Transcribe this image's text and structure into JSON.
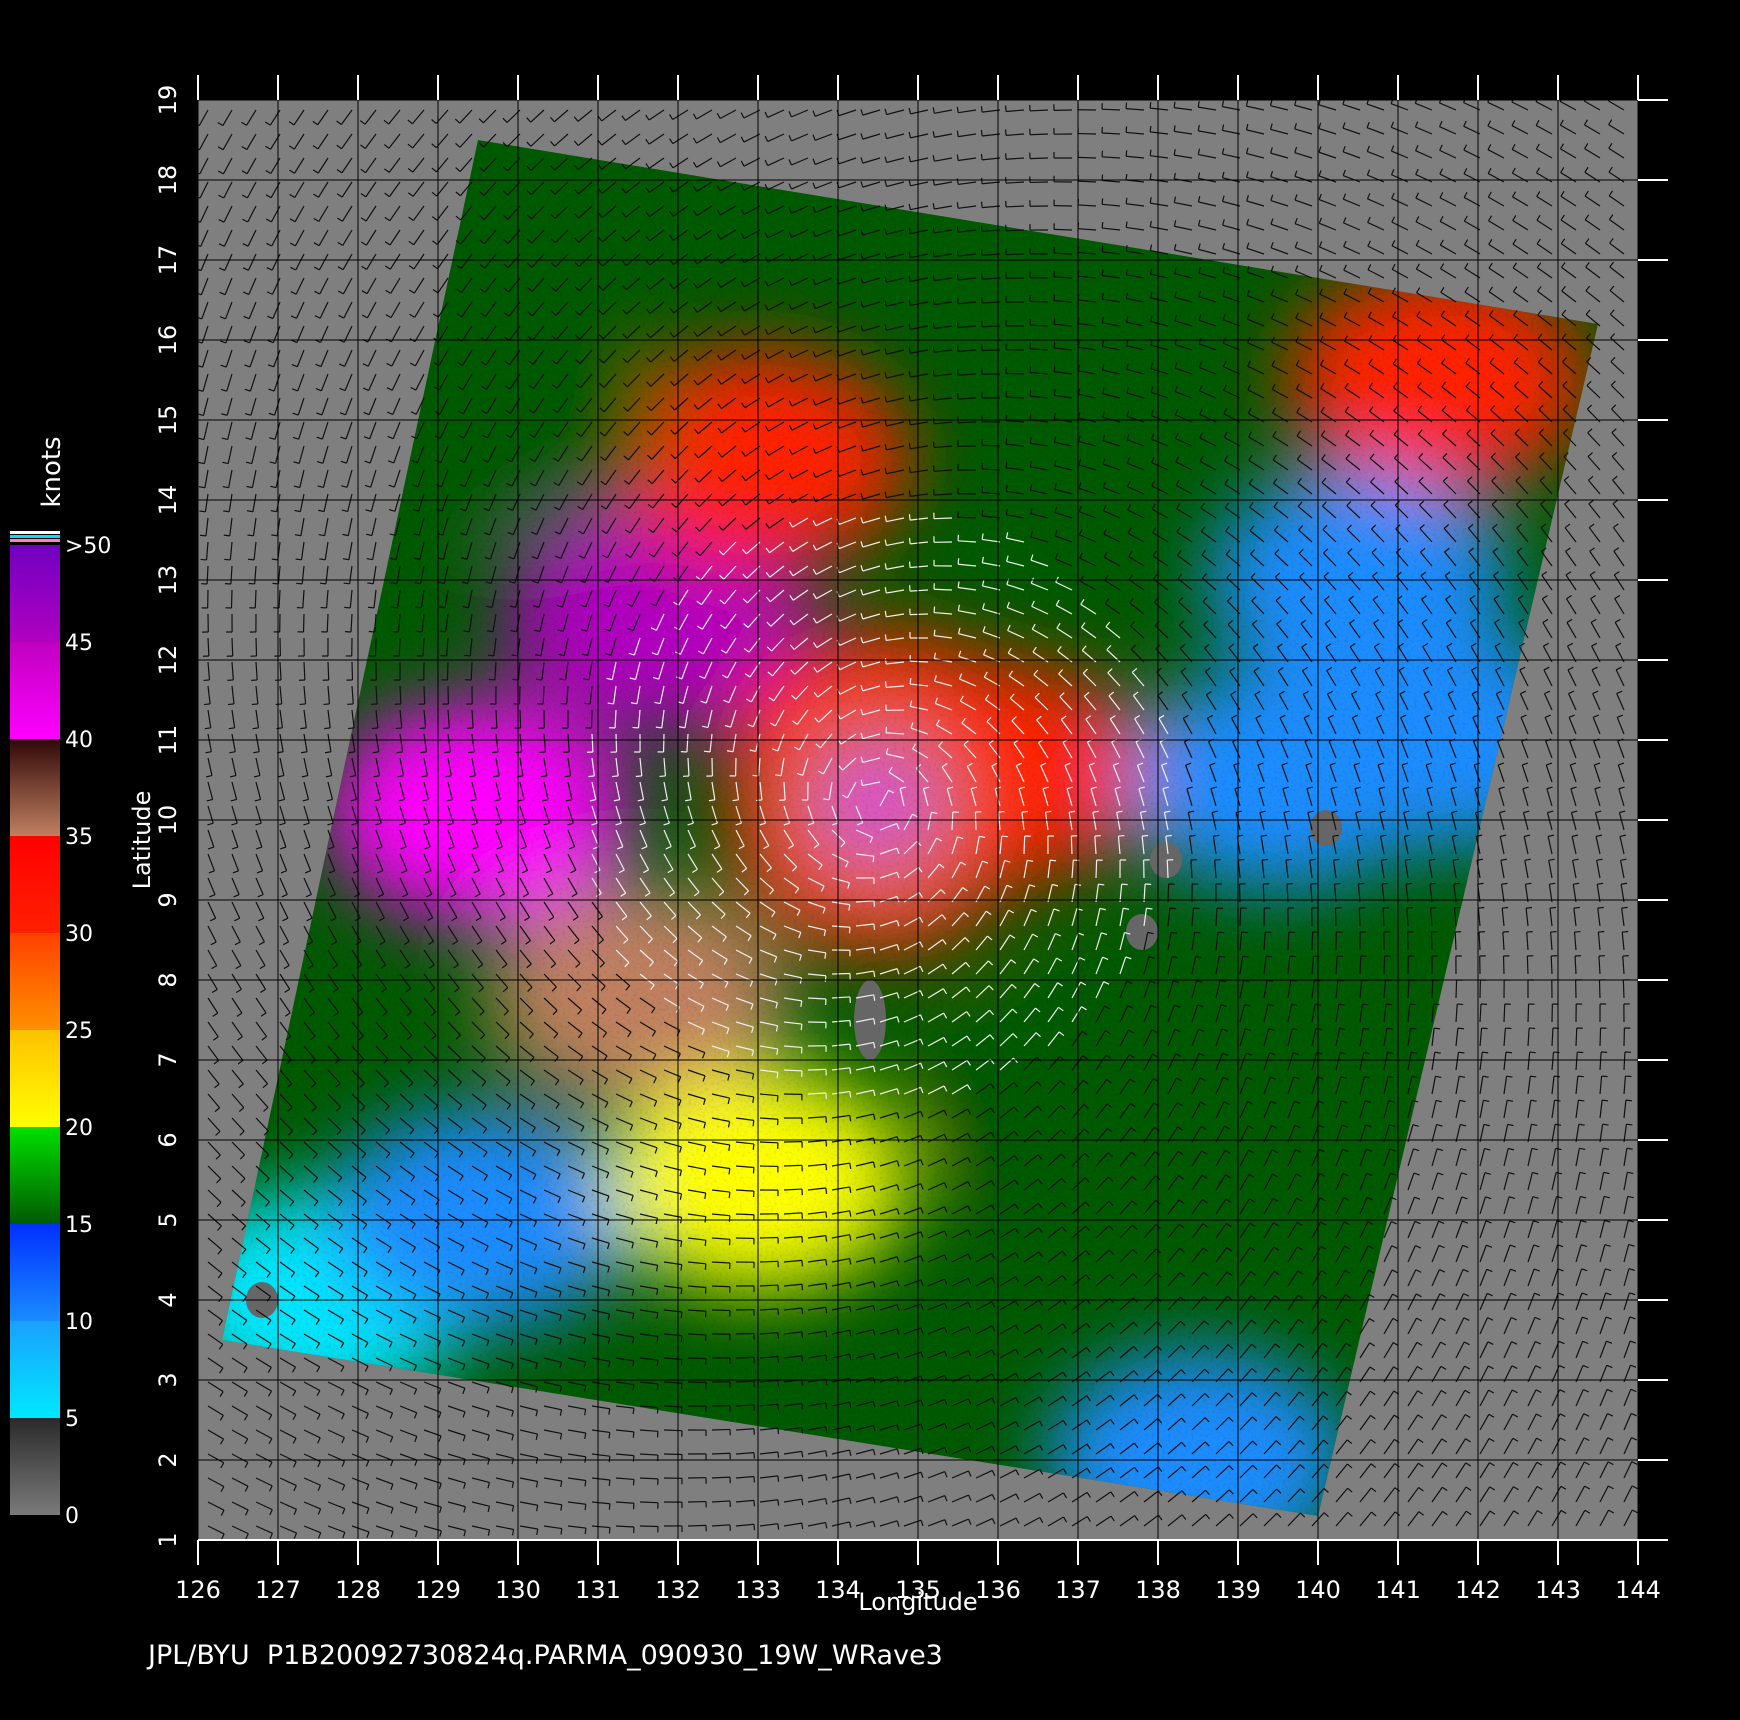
{
  "footer": "JPL/BYU  P1B20092730824q.PARMA_090930_19W_WRave3",
  "axes": {
    "xlabel": "Longitude",
    "ylabel": "Latitude",
    "x_ticks": [
      "126",
      "127",
      "128",
      "129",
      "130",
      "131",
      "132",
      "133",
      "134",
      "135",
      "136",
      "137",
      "138",
      "139",
      "140",
      "141",
      "142",
      "143",
      "144"
    ],
    "y_ticks": [
      "1",
      "2",
      "3",
      "4",
      "5",
      "6",
      "7",
      "8",
      "9",
      "10",
      "11",
      "12",
      "13",
      "14",
      "15",
      "16",
      "17",
      "18",
      "19"
    ],
    "xlim": [
      126,
      144
    ],
    "ylim": [
      1,
      19
    ]
  },
  "colorbar": {
    "title": "knots",
    "labels": [
      "0",
      "5",
      "10",
      "15",
      "20",
      "25",
      "30",
      "35",
      "40",
      "45",
      ">50"
    ],
    "bands": [
      {
        "from": 0,
        "to": 5,
        "colors": [
          "#7a7a7a",
          "#2a2a2a"
        ]
      },
      {
        "from": 5,
        "to": 10,
        "colors": [
          "#00e8ff",
          "#1aa0ff"
        ]
      },
      {
        "from": 10,
        "to": 15,
        "colors": [
          "#1a8cff",
          "#0030ff"
        ]
      },
      {
        "from": 15,
        "to": 20,
        "colors": [
          "#005a00",
          "#00e000"
        ]
      },
      {
        "from": 20,
        "to": 25,
        "colors": [
          "#ffff00",
          "#ffc000"
        ]
      },
      {
        "from": 25,
        "to": 30,
        "colors": [
          "#ff9000",
          "#ff4000"
        ]
      },
      {
        "from": 30,
        "to": 35,
        "colors": [
          "#ff2000",
          "#ff0000"
        ]
      },
      {
        "from": 35,
        "to": 40,
        "colors": [
          "#c08060",
          "#300808"
        ]
      },
      {
        "from": 40,
        "to": 45,
        "colors": [
          "#ff00ff",
          "#c000c0"
        ]
      },
      {
        "from": 45,
        "to": 50,
        "colors": [
          "#b000c0",
          "#7000c0"
        ]
      }
    ]
  },
  "map_data": {
    "type": "scatterometer_wind_field",
    "background_color": "#7f7f7f",
    "storm_center": {
      "lon": 134.5,
      "lat": 10.2,
      "speed_knots": 50
    },
    "swath_corners": [
      [
        129.5,
        18.5
      ],
      [
        143.5,
        16.2
      ],
      [
        140,
        1.3
      ],
      [
        126.3,
        3.5
      ]
    ],
    "wind_regions": [
      {
        "lon": 129.5,
        "lat": 10.1,
        "speed": 40
      },
      {
        "lon": 131.7,
        "lat": 12.5,
        "speed": 45
      },
      {
        "lon": 131.5,
        "lat": 7.8,
        "speed": 38
      },
      {
        "lon": 134.5,
        "lat": 11.0,
        "speed": 32
      },
      {
        "lon": 136.0,
        "lat": 10.6,
        "speed": 30
      },
      {
        "lon": 141.5,
        "lat": 15.5,
        "speed": 33
      },
      {
        "lon": 133.0,
        "lat": 14.5,
        "speed": 30
      },
      {
        "lon": 139.5,
        "lat": 10.5,
        "speed": 12
      },
      {
        "lon": 140.5,
        "lat": 13.0,
        "speed": 14
      },
      {
        "lon": 141.5,
        "lat": 11.0,
        "speed": 13
      },
      {
        "lon": 127.5,
        "lat": 4.0,
        "speed": 8
      },
      {
        "lon": 129.5,
        "lat": 5.0,
        "speed": 12
      },
      {
        "lon": 138.5,
        "lat": 2.0,
        "speed": 14
      },
      {
        "lon": 130.0,
        "lat": 15.0,
        "speed": 18
      },
      {
        "lon": 133.0,
        "lat": 5.5,
        "speed": 22
      },
      {
        "lon": 137.0,
        "lat": 6.5,
        "speed": 18
      }
    ],
    "land_patches": [
      {
        "lon": 134.4,
        "lat": 7.5,
        "name": "palau"
      },
      {
        "lon": 140.1,
        "lat": 9.9,
        "name": "island"
      },
      {
        "lon": 137.8,
        "lat": 8.6,
        "name": "island"
      },
      {
        "lon": 138.1,
        "lat": 9.5,
        "name": "island"
      },
      {
        "lon": 126.8,
        "lat": 4.0,
        "name": "island"
      }
    ]
  }
}
